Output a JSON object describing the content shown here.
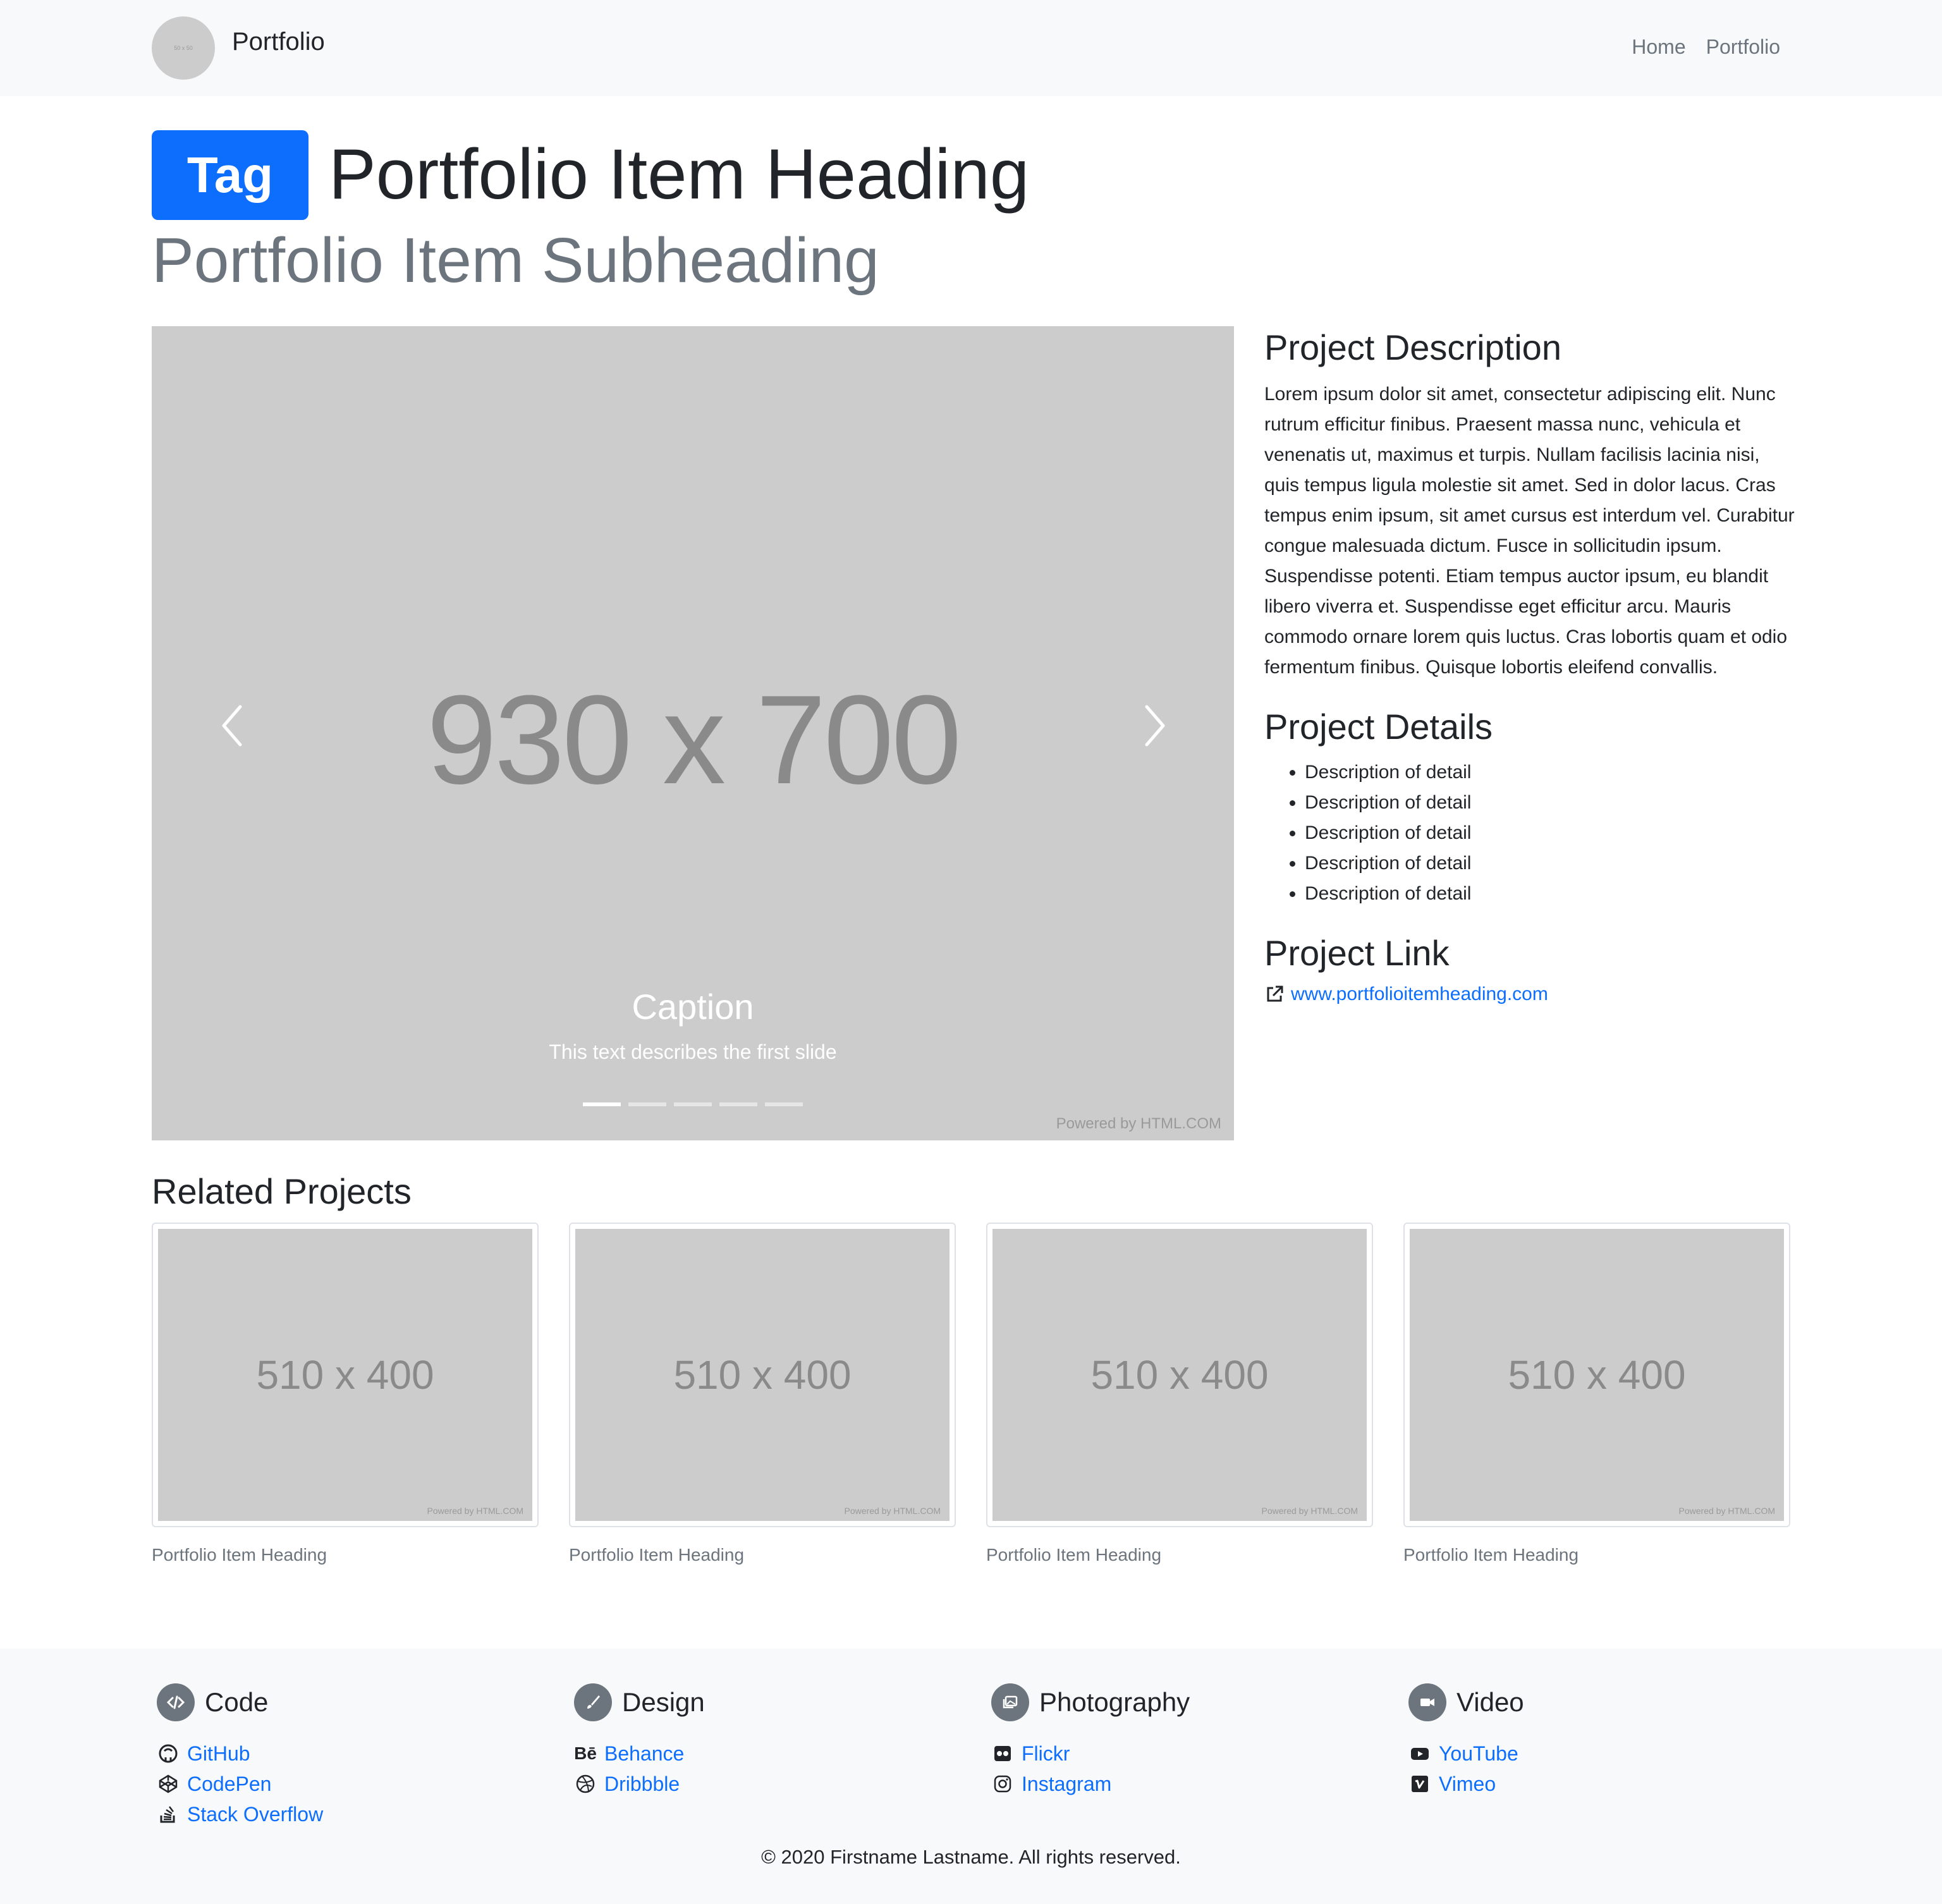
{
  "navbar": {
    "avatar_text": "50 x 50",
    "brand": "Portfolio",
    "links": [
      "Home",
      "Portfolio"
    ]
  },
  "header": {
    "tag": "Tag",
    "heading": "Portfolio Item Heading",
    "subheading": "Portfolio Item Subheading"
  },
  "carousel": {
    "placeholder": "930 x 700",
    "caption_title": "Caption",
    "caption_text": "This text describes the first slide",
    "powered": "Powered by HTML.COM",
    "slide_count": 5,
    "active_slide": 1
  },
  "sidebar": {
    "description_title": "Project Description",
    "description": "Lorem ipsum dolor sit amet, consectetur adipiscing elit. Nunc rutrum efficitur finibus. Praesent massa nunc, vehicula et venenatis ut, maximus et turpis. Nullam facilisis lacinia nisi, quis tempus ligula molestie sit amet. Sed in dolor lacus. Cras tempus enim ipsum, sit amet cursus est interdum vel. Curabitur congue malesuada dictum. Fusce in sollicitudin ipsum. Suspendisse potenti. Etiam tempus auctor ipsum, eu blandit libero viverra et. Suspendisse eget efficitur arcu. Mauris commodo ornare lorem quis luctus. Cras lobortis quam et odio fermentum finibus. Quisque lobortis eleifend convallis.",
    "details_title": "Project Details",
    "details": [
      "Description of detail",
      "Description of detail",
      "Description of detail",
      "Description of detail",
      "Description of detail"
    ],
    "link_title": "Project Link",
    "link_text": "www.portfolioitemheading.com"
  },
  "related": {
    "title": "Related Projects",
    "cards": [
      {
        "placeholder": "510 x 400",
        "powered": "Powered by HTML.COM",
        "caption": "Portfolio Item Heading"
      },
      {
        "placeholder": "510 x 400",
        "powered": "Powered by HTML.COM",
        "caption": "Portfolio Item Heading"
      },
      {
        "placeholder": "510 x 400",
        "powered": "Powered by HTML.COM",
        "caption": "Portfolio Item Heading"
      },
      {
        "placeholder": "510 x 400",
        "powered": "Powered by HTML.COM",
        "caption": "Portfolio Item Heading"
      }
    ]
  },
  "footer": {
    "columns": [
      {
        "title": "Code",
        "icon": "code-icon",
        "links": [
          {
            "label": "GitHub",
            "icon": "github-icon"
          },
          {
            "label": "CodePen",
            "icon": "codepen-icon"
          },
          {
            "label": "Stack Overflow",
            "icon": "stackoverflow-icon"
          }
        ]
      },
      {
        "title": "Design",
        "icon": "brush-icon",
        "links": [
          {
            "label": "Behance",
            "icon": "behance-icon"
          },
          {
            "label": "Dribbble",
            "icon": "dribbble-icon"
          }
        ]
      },
      {
        "title": "Photography",
        "icon": "images-icon",
        "links": [
          {
            "label": "Flickr",
            "icon": "flickr-icon"
          },
          {
            "label": "Instagram",
            "icon": "instagram-icon"
          }
        ]
      },
      {
        "title": "Video",
        "icon": "video-icon",
        "links": [
          {
            "label": "YouTube",
            "icon": "youtube-icon"
          },
          {
            "label": "Vimeo",
            "icon": "vimeo-icon"
          }
        ]
      }
    ],
    "copyright": "© 2020 Firstname Lastname. All rights reserved."
  },
  "colors": {
    "primary": "#0d6efd",
    "navbar_bg": "#f8f9fa",
    "placeholder_bg": "#cccccc",
    "muted": "#6c757d"
  }
}
